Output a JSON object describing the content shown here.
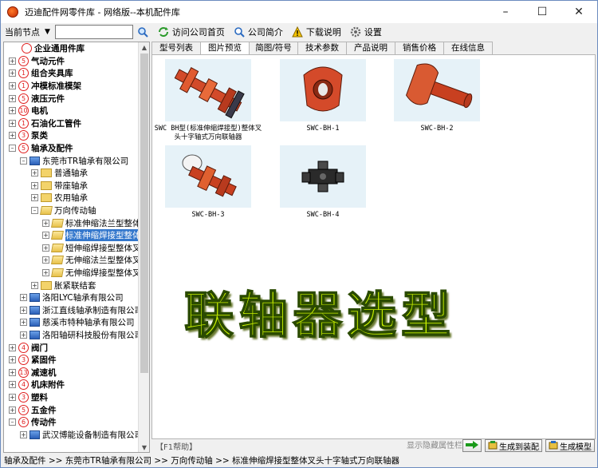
{
  "window": {
    "title": "迈迪配件网零件库 - 网络版--本机配件库"
  },
  "toolbar": {
    "current_node_label": "当前节点",
    "search_value": "",
    "visit_home": "访问公司首页",
    "company_intro": "公司简介",
    "download_help": "下载说明",
    "settings": "设置"
  },
  "tree": {
    "categories_top": [
      {
        "num": "",
        "label": "企业通用件库"
      },
      {
        "num": "5",
        "label": "气动元件"
      },
      {
        "num": "1",
        "label": "组合夹具库"
      },
      {
        "num": "1",
        "label": "冲模标准模架"
      },
      {
        "num": "5",
        "label": "液压元件"
      },
      {
        "num": "10",
        "label": "电机"
      },
      {
        "num": "1",
        "label": "石油化工管件"
      },
      {
        "num": "3",
        "label": "泵类"
      },
      {
        "num": "5",
        "label": "轴承及配件"
      }
    ],
    "company_tr": "东莞市TR轴承有限公司",
    "sub_folders": [
      "普通轴承",
      "带座轴承",
      "农用轴承"
    ],
    "universal": "万向传动轴",
    "universal_children": [
      "标准伸缩法兰型整体叉",
      "标准伸缩焊接型整体叉",
      "短伸缩焊接型整体叉头",
      "无伸缩法兰型整体叉头",
      "无伸缩焊接型整体叉头"
    ],
    "expansion_sleeve": "胀紧联结套",
    "companies": [
      "洛阳LYC轴承有限公司",
      "浙江直线轴承制造有限公司",
      "慈溪市特种轴承有限公司",
      "洛阳轴研科技股份有限公司"
    ],
    "categories_bottom": [
      {
        "num": "4",
        "label": "阀门"
      },
      {
        "num": "3",
        "label": "紧固件"
      },
      {
        "num": "13",
        "label": "减速机"
      },
      {
        "num": "4",
        "label": "机床附件"
      },
      {
        "num": "3",
        "label": "塑料"
      },
      {
        "num": "5",
        "label": "五金件"
      },
      {
        "num": "6",
        "label": "传动件"
      }
    ],
    "last_company": "武汉博能设备制造有限公司"
  },
  "tabs": [
    "型号列表",
    "图片预览",
    "简图/符号",
    "技术参数",
    "产品说明",
    "销售价格",
    "在线信息"
  ],
  "active_tab_index": 1,
  "thumbnails": [
    {
      "caption": "SWC BH型(标准伸缩焊接型)整体叉头十字轴式万向联轴器"
    },
    {
      "caption": "SWC-BH-1"
    },
    {
      "caption": "SWC-BH-2"
    },
    {
      "caption": "SWC-BH-3"
    },
    {
      "caption": "SWC-BH-4"
    }
  ],
  "watermark_text": "联轴器选型",
  "bottombar": {
    "help": "【F1帮助】",
    "show_hide": "显示隐藏属性栏",
    "gen_assembly": "生成到装配",
    "gen_model": "生成模型"
  },
  "statusbar": {
    "path": "轴承及配件 >> 东莞市TR轴承有限公司 >> 万向传动轴 >> 标准伸缩焊接型整体叉头十字轴式万向联轴器"
  },
  "colors": {
    "accent": "#3377cc",
    "red_badge": "#e02020",
    "watermark_fill": "#c8f000"
  }
}
